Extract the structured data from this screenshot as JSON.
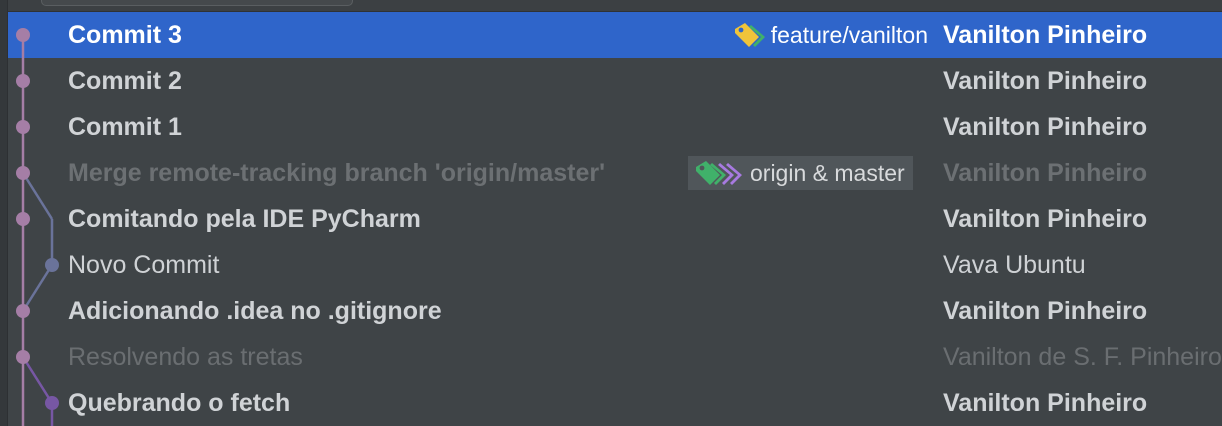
{
  "commits": [
    {
      "subject": "Commit 3",
      "author": "Vanilton Pinheiro",
      "ref": "feature/vanilton"
    },
    {
      "subject": "Commit 2",
      "author": "Vanilton Pinheiro"
    },
    {
      "subject": "Commit 1",
      "author": "Vanilton Pinheiro"
    },
    {
      "subject": "Merge remote-tracking branch 'origin/master'",
      "author": "Vanilton Pinheiro",
      "ref": "origin & master"
    },
    {
      "subject": "Comitando pela IDE PyCharm",
      "author": "Vanilton Pinheiro"
    },
    {
      "subject": "Novo Commit",
      "author": "Vava Ubuntu"
    },
    {
      "subject": "Adicionando .idea no .gitignore",
      "author": "Vanilton Pinheiro"
    },
    {
      "subject": "Resolvendo as tretas",
      "author": "Vanilton de S. F. Pinheiro"
    },
    {
      "subject": "Quebrando o fetch",
      "author": "Vanilton Pinheiro"
    }
  ],
  "icons": {
    "feature_ref": "tag-icon",
    "origin_ref": "tags-icon"
  },
  "colors": {
    "selection": "#2f65ca",
    "graph_main": "#a57ea6",
    "graph_branch": "#6a739a",
    "graph_merge": "#7757a4",
    "tag_yellow": "#f0c43a",
    "tag_green": "#40b16a",
    "tag_purple": "#a77ae0"
  }
}
